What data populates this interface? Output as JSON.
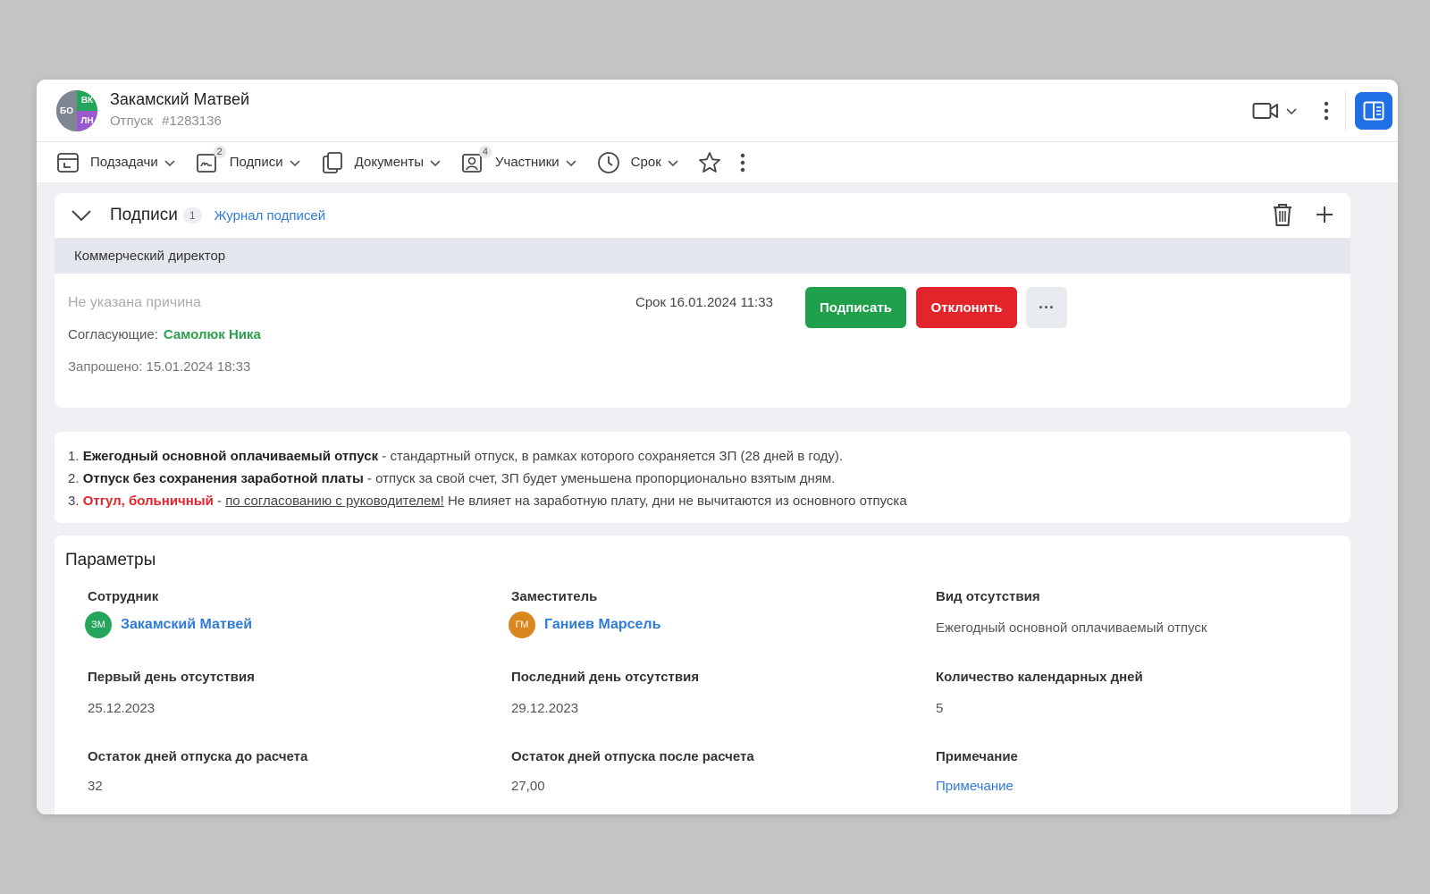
{
  "header": {
    "avatar_initials": [
      "БО",
      "ВК",
      "ЛН"
    ],
    "title": "Закамский Матвей",
    "subtitle_type": "Отпуск",
    "subtitle_id": "#1283136"
  },
  "toolbar": {
    "items": [
      {
        "label": "Подзадачи",
        "icon": "subtasks-icon",
        "badge": ""
      },
      {
        "label": "Подписи",
        "icon": "signature-icon",
        "badge": "2"
      },
      {
        "label": "Документы",
        "icon": "documents-icon",
        "badge": ""
      },
      {
        "label": "Участники",
        "icon": "participants-icon",
        "badge": "4"
      },
      {
        "label": "Срок",
        "icon": "clock-icon",
        "badge": ""
      }
    ]
  },
  "signatures": {
    "title": "Подписи",
    "count": "1",
    "journal_link": "Журнал подписей",
    "role": "Коммерческий директор",
    "reason": "Не указана причина",
    "approvers_label": "Согласующие:",
    "approver_name": "Самолюк Ника",
    "requested": "Запрошено: 15.01.2024 18:33",
    "deadline": "Срок 16.01.2024 11:33",
    "sign_button": "Подписать",
    "reject_button": "Отклонить",
    "more_button": "···"
  },
  "info": {
    "line1_num": "1.",
    "line1_bold": "Ежегодный основной оплачиваемый отпуск",
    "line1_rest": " - стандартный отпуск, в рамках которого сохраняется ЗП (28 дней в году).",
    "line2_num": "2.",
    "line2_bold": "Отпуск без сохранения заработной платы",
    "line2_rest": " - отпуск за свой счет, ЗП будет уменьшена пропорционально взятым дням.",
    "line3_num": "3.",
    "line3_red": "Отгул, больничный",
    "line3_dash": " - ",
    "line3_underline": "по согласованию с руководителем!",
    "line3_rest": " Не влияет на заработную плату, дни не вычитаются из основного отпуска"
  },
  "params": {
    "title": "Параметры",
    "employee_label": "Сотрудник",
    "employee_initials": "ЗМ",
    "employee_name": "Закамский Матвей",
    "deputy_label": "Заместитель",
    "deputy_initials": "ГМ",
    "deputy_name": "Ганиев Марсель",
    "absence_type_label": "Вид отсутствия",
    "absence_type_value": "Ежегодный основной оплачиваемый отпуск",
    "first_day_label": "Первый день отсутствия",
    "first_day_value": "25.12.2023",
    "last_day_label": "Последний день отсутствия",
    "last_day_value": "29.12.2023",
    "days_count_label": "Количество календарных дней",
    "days_count_value": "5",
    "balance_before_label": "Остаток дней отпуска до расчета",
    "balance_before_value": "32",
    "balance_after_label": "Остаток дней отпуска после расчета",
    "balance_after_value": "27,00",
    "note_label": "Примечание",
    "note_value": "Примечание"
  },
  "colors": {
    "accent_blue": "#2f7bd8",
    "sign_green": "#21a04c",
    "reject_red": "#e3242b",
    "employee_avatar": "#23a55a",
    "deputy_avatar": "#d9861e"
  }
}
